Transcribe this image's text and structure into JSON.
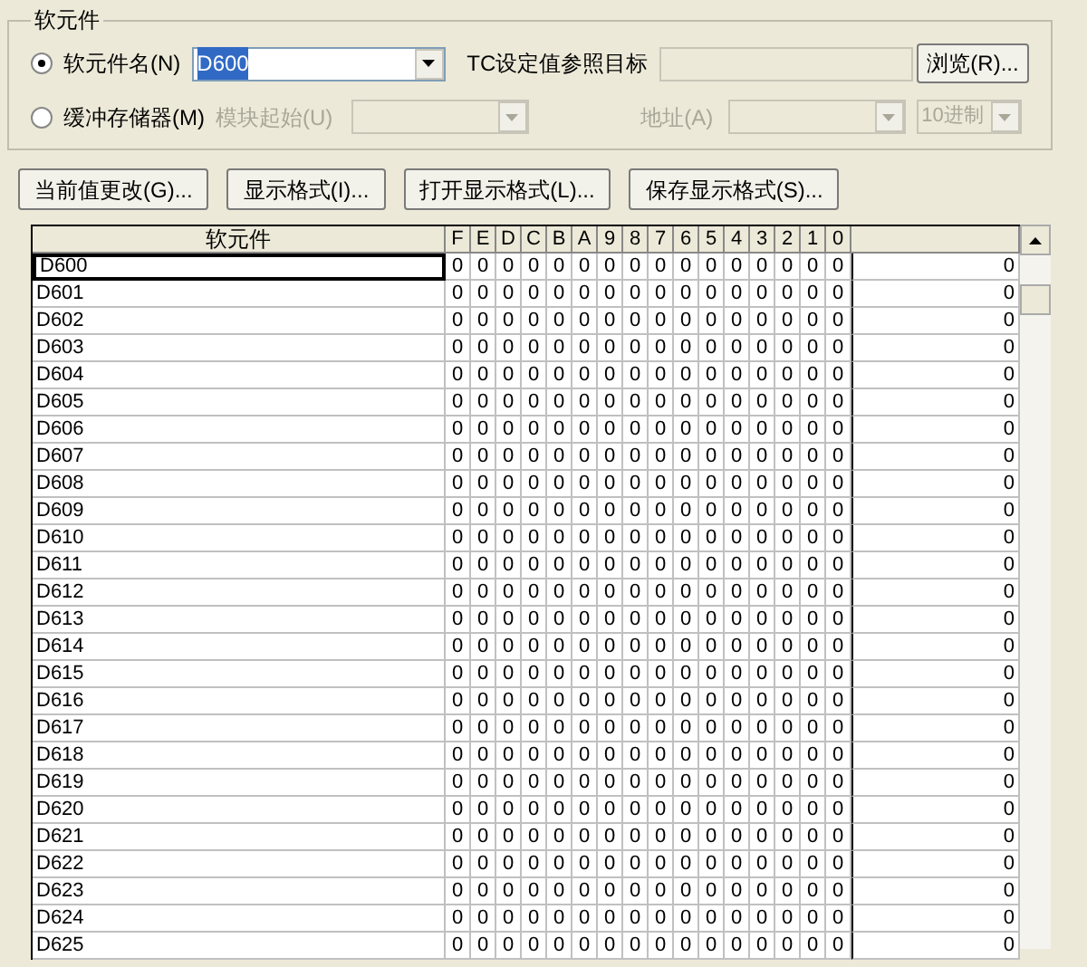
{
  "device_group": {
    "title": "软元件",
    "radios": [
      {
        "label": "软元件名(N)",
        "selected": true
      },
      {
        "label": "缓冲存储器(M)",
        "selected": false
      }
    ],
    "device_name": {
      "value": "D600"
    },
    "tc_label": "TC设定值参照目标",
    "browse_button": "浏览(R)...",
    "module_start": {
      "label": "模块起始(U)",
      "disabled": true
    },
    "address": {
      "label": "地址(A)",
      "disabled": true
    },
    "radix": {
      "value": "10进制",
      "disabled": true
    }
  },
  "buttons": [
    "当前值更改(G)...",
    "显示格式(I)...",
    "打开显示格式(L)...",
    "保存显示格式(S)..."
  ],
  "table": {
    "columns": [
      "软元件",
      "F",
      "E",
      "D",
      "C",
      "B",
      "A",
      "9",
      "8",
      "7",
      "6",
      "5",
      "4",
      "3",
      "2",
      "1",
      "0"
    ],
    "rows": [
      {
        "device": "D600",
        "bits": [
          "0",
          "0",
          "0",
          "0",
          "0",
          "0",
          "0",
          "0",
          "0",
          "0",
          "0",
          "0",
          "0",
          "0",
          "0",
          "0"
        ],
        "value": "0",
        "selected": true
      },
      {
        "device": "D601",
        "bits": [
          "0",
          "0",
          "0",
          "0",
          "0",
          "0",
          "0",
          "0",
          "0",
          "0",
          "0",
          "0",
          "0",
          "0",
          "0",
          "0"
        ],
        "value": "0",
        "selected": false
      },
      {
        "device": "D602",
        "bits": [
          "0",
          "0",
          "0",
          "0",
          "0",
          "0",
          "0",
          "0",
          "0",
          "0",
          "0",
          "0",
          "0",
          "0",
          "0",
          "0"
        ],
        "value": "0",
        "selected": false
      },
      {
        "device": "D603",
        "bits": [
          "0",
          "0",
          "0",
          "0",
          "0",
          "0",
          "0",
          "0",
          "0",
          "0",
          "0",
          "0",
          "0",
          "0",
          "0",
          "0"
        ],
        "value": "0",
        "selected": false
      },
      {
        "device": "D604",
        "bits": [
          "0",
          "0",
          "0",
          "0",
          "0",
          "0",
          "0",
          "0",
          "0",
          "0",
          "0",
          "0",
          "0",
          "0",
          "0",
          "0"
        ],
        "value": "0",
        "selected": false
      },
      {
        "device": "D605",
        "bits": [
          "0",
          "0",
          "0",
          "0",
          "0",
          "0",
          "0",
          "0",
          "0",
          "0",
          "0",
          "0",
          "0",
          "0",
          "0",
          "0"
        ],
        "value": "0",
        "selected": false
      },
      {
        "device": "D606",
        "bits": [
          "0",
          "0",
          "0",
          "0",
          "0",
          "0",
          "0",
          "0",
          "0",
          "0",
          "0",
          "0",
          "0",
          "0",
          "0",
          "0"
        ],
        "value": "0",
        "selected": false
      },
      {
        "device": "D607",
        "bits": [
          "0",
          "0",
          "0",
          "0",
          "0",
          "0",
          "0",
          "0",
          "0",
          "0",
          "0",
          "0",
          "0",
          "0",
          "0",
          "0"
        ],
        "value": "0",
        "selected": false
      },
      {
        "device": "D608",
        "bits": [
          "0",
          "0",
          "0",
          "0",
          "0",
          "0",
          "0",
          "0",
          "0",
          "0",
          "0",
          "0",
          "0",
          "0",
          "0",
          "0"
        ],
        "value": "0",
        "selected": false
      },
      {
        "device": "D609",
        "bits": [
          "0",
          "0",
          "0",
          "0",
          "0",
          "0",
          "0",
          "0",
          "0",
          "0",
          "0",
          "0",
          "0",
          "0",
          "0",
          "0"
        ],
        "value": "0",
        "selected": false
      },
      {
        "device": "D610",
        "bits": [
          "0",
          "0",
          "0",
          "0",
          "0",
          "0",
          "0",
          "0",
          "0",
          "0",
          "0",
          "0",
          "0",
          "0",
          "0",
          "0"
        ],
        "value": "0",
        "selected": false
      },
      {
        "device": "D611",
        "bits": [
          "0",
          "0",
          "0",
          "0",
          "0",
          "0",
          "0",
          "0",
          "0",
          "0",
          "0",
          "0",
          "0",
          "0",
          "0",
          "0"
        ],
        "value": "0",
        "selected": false
      },
      {
        "device": "D612",
        "bits": [
          "0",
          "0",
          "0",
          "0",
          "0",
          "0",
          "0",
          "0",
          "0",
          "0",
          "0",
          "0",
          "0",
          "0",
          "0",
          "0"
        ],
        "value": "0",
        "selected": false
      },
      {
        "device": "D613",
        "bits": [
          "0",
          "0",
          "0",
          "0",
          "0",
          "0",
          "0",
          "0",
          "0",
          "0",
          "0",
          "0",
          "0",
          "0",
          "0",
          "0"
        ],
        "value": "0",
        "selected": false
      },
      {
        "device": "D614",
        "bits": [
          "0",
          "0",
          "0",
          "0",
          "0",
          "0",
          "0",
          "0",
          "0",
          "0",
          "0",
          "0",
          "0",
          "0",
          "0",
          "0"
        ],
        "value": "0",
        "selected": false
      },
      {
        "device": "D615",
        "bits": [
          "0",
          "0",
          "0",
          "0",
          "0",
          "0",
          "0",
          "0",
          "0",
          "0",
          "0",
          "0",
          "0",
          "0",
          "0",
          "0"
        ],
        "value": "0",
        "selected": false
      },
      {
        "device": "D616",
        "bits": [
          "0",
          "0",
          "0",
          "0",
          "0",
          "0",
          "0",
          "0",
          "0",
          "0",
          "0",
          "0",
          "0",
          "0",
          "0",
          "0"
        ],
        "value": "0",
        "selected": false
      },
      {
        "device": "D617",
        "bits": [
          "0",
          "0",
          "0",
          "0",
          "0",
          "0",
          "0",
          "0",
          "0",
          "0",
          "0",
          "0",
          "0",
          "0",
          "0",
          "0"
        ],
        "value": "0",
        "selected": false
      },
      {
        "device": "D618",
        "bits": [
          "0",
          "0",
          "0",
          "0",
          "0",
          "0",
          "0",
          "0",
          "0",
          "0",
          "0",
          "0",
          "0",
          "0",
          "0",
          "0"
        ],
        "value": "0",
        "selected": false
      },
      {
        "device": "D619",
        "bits": [
          "0",
          "0",
          "0",
          "0",
          "0",
          "0",
          "0",
          "0",
          "0",
          "0",
          "0",
          "0",
          "0",
          "0",
          "0",
          "0"
        ],
        "value": "0",
        "selected": false
      },
      {
        "device": "D620",
        "bits": [
          "0",
          "0",
          "0",
          "0",
          "0",
          "0",
          "0",
          "0",
          "0",
          "0",
          "0",
          "0",
          "0",
          "0",
          "0",
          "0"
        ],
        "value": "0",
        "selected": false
      },
      {
        "device": "D621",
        "bits": [
          "0",
          "0",
          "0",
          "0",
          "0",
          "0",
          "0",
          "0",
          "0",
          "0",
          "0",
          "0",
          "0",
          "0",
          "0",
          "0"
        ],
        "value": "0",
        "selected": false
      },
      {
        "device": "D622",
        "bits": [
          "0",
          "0",
          "0",
          "0",
          "0",
          "0",
          "0",
          "0",
          "0",
          "0",
          "0",
          "0",
          "0",
          "0",
          "0",
          "0"
        ],
        "value": "0",
        "selected": false
      },
      {
        "device": "D623",
        "bits": [
          "0",
          "0",
          "0",
          "0",
          "0",
          "0",
          "0",
          "0",
          "0",
          "0",
          "0",
          "0",
          "0",
          "0",
          "0",
          "0"
        ],
        "value": "0",
        "selected": false
      },
      {
        "device": "D624",
        "bits": [
          "0",
          "0",
          "0",
          "0",
          "0",
          "0",
          "0",
          "0",
          "0",
          "0",
          "0",
          "0",
          "0",
          "0",
          "0",
          "0"
        ],
        "value": "0",
        "selected": false
      },
      {
        "device": "D625",
        "bits": [
          "0",
          "0",
          "0",
          "0",
          "0",
          "0",
          "0",
          "0",
          "0",
          "0",
          "0",
          "0",
          "0",
          "0",
          "0",
          "0"
        ],
        "value": "0",
        "selected": false
      }
    ]
  }
}
